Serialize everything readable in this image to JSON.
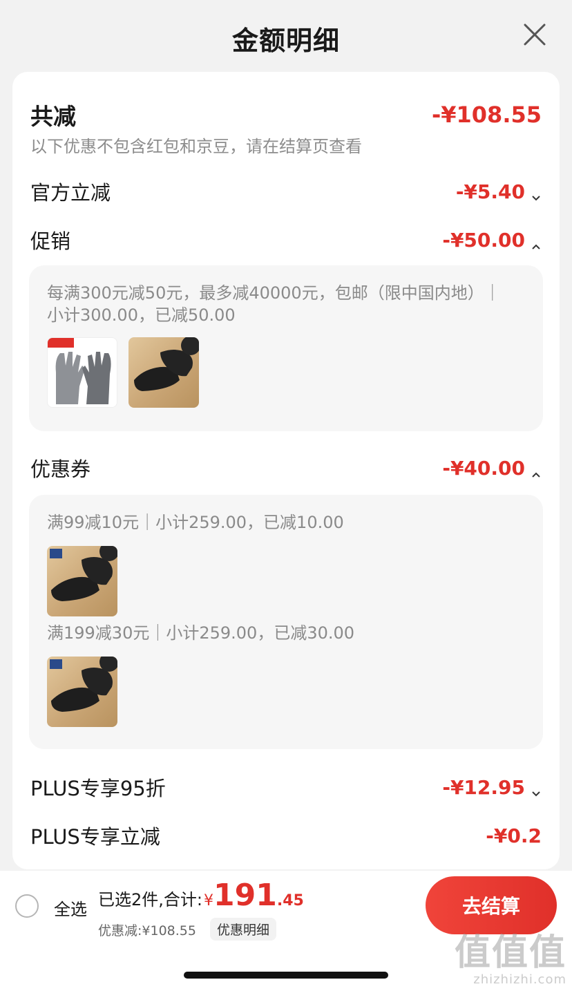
{
  "sheet": {
    "title": "金额明细"
  },
  "summary_card": {
    "total_label": "共减",
    "total_amount": "-¥108.55",
    "note": "以下优惠不包含红包和京豆，请在结算页查看",
    "rows": {
      "official": {
        "label": "官方立减",
        "amount": "-¥5.40"
      },
      "promotion": {
        "label": "促销",
        "amount": "-¥50.00"
      },
      "coupon": {
        "label": "优惠券",
        "amount": "-¥40.00"
      },
      "plus_discount": {
        "label": "PLUS专享95折",
        "amount": "-¥12.95"
      },
      "plus_reduce": {
        "label": "PLUS专享立减",
        "amount": "-¥0.2"
      }
    },
    "promotion_panel": {
      "text": "每满300元减50元，最多减40000元，包邮（限中国内地）｜小计300.00，已减50.00",
      "products": [
        "gloves",
        "shoes"
      ]
    },
    "coupon_panel": {
      "coupon1_text": "满99减10元｜小计259.00，已减10.00",
      "coupon2_text": "满199减30元｜小计259.00，已减30.00"
    }
  },
  "bottom_bar": {
    "select_all": "全选",
    "selected_text": "已选2件,合计:",
    "currency": "¥",
    "price_main": "191",
    "price_decimal": ".45",
    "discount_text": "优惠减:¥108.55",
    "detail_tag": "优惠明细",
    "checkout_button": "去结算"
  },
  "watermark": {
    "big": "值值值",
    "small": "zhizhizhi.com"
  },
  "colors": {
    "accent": "#e0302a",
    "background": "#f2f2f2",
    "panel": "#f6f6f6"
  }
}
